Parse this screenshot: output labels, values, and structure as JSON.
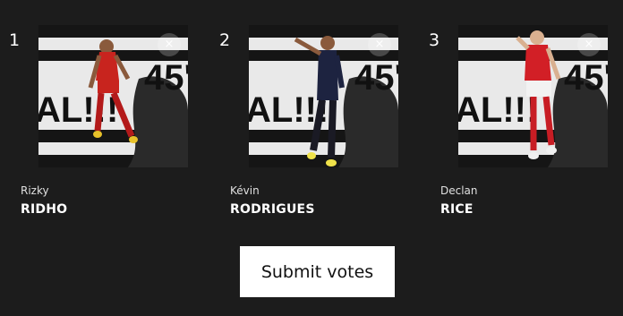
{
  "candidates": [
    {
      "rank": "1",
      "first_name": "Rizky",
      "last_name": "RIDHO",
      "remove_icon": "×",
      "kit_colors": {
        "shirt": "#c8241e",
        "shorts": "#c8241e",
        "socks": "#b31a1a",
        "boots": "#e8c22a"
      }
    },
    {
      "rank": "2",
      "first_name": "Kévin",
      "last_name": "RODRIGUES",
      "remove_icon": "×",
      "kit_colors": {
        "shirt": "#1d2340",
        "shorts": "#1a1a24",
        "socks": "#1a1a24",
        "boots": "#f0e24a"
      }
    },
    {
      "rank": "3",
      "first_name": "Declan",
      "last_name": "RICE",
      "remove_icon": "×",
      "kit_colors": {
        "shirt": "#d21f26",
        "shorts": "#f2f2f2",
        "socks": "#c81d24",
        "boots": "#f0f0f0"
      }
    }
  ],
  "card_art": {
    "left_text": "AL!!!",
    "right_text": "45'"
  },
  "submit_label": "Submit votes",
  "colors": {
    "background": "#1c1c1c",
    "button_bg": "#ffffff",
    "button_text": "#111111",
    "text": "#ffffff"
  }
}
